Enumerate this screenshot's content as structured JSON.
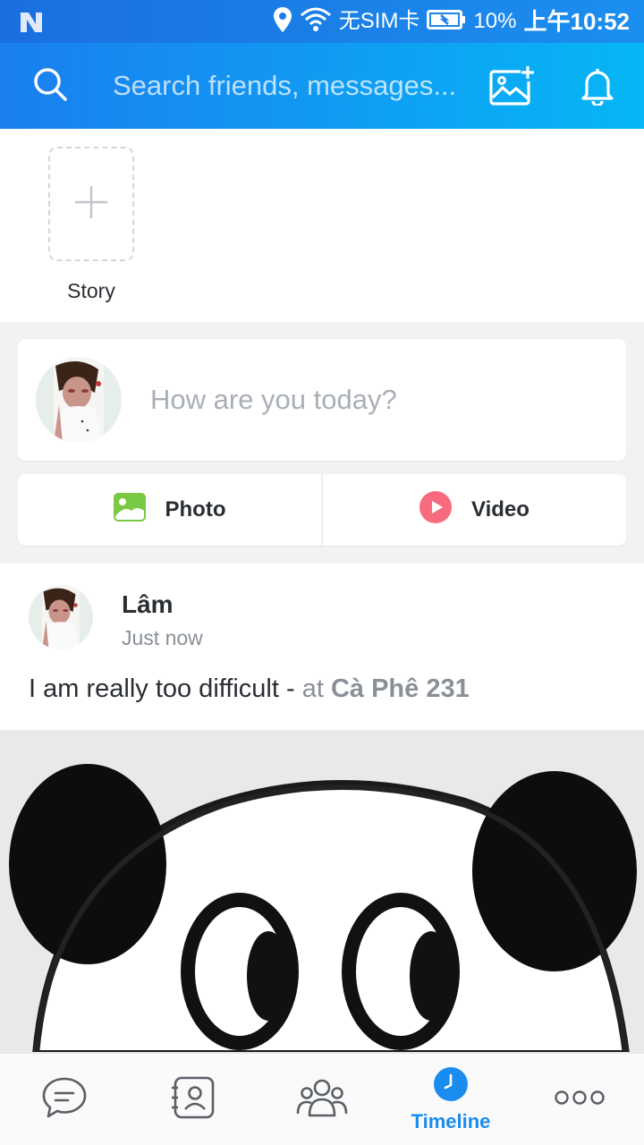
{
  "status_bar": {
    "carrier": "无SIM卡",
    "battery": "10%",
    "time": "上午10:52"
  },
  "search": {
    "placeholder": "Search friends, messages..."
  },
  "story": {
    "label": "Story"
  },
  "composer": {
    "placeholder": "How are you today?",
    "photo_label": "Photo",
    "video_label": "Video"
  },
  "post": {
    "author": "Lâm",
    "time": "Just now",
    "text": "I am really too difficult - ",
    "at_word": "at ",
    "place": "Cà Phê 231"
  },
  "bottom_nav": {
    "timeline_label": "Timeline"
  },
  "colors": {
    "accent": "#1a8cf0",
    "header_start": "#1b7ff0",
    "header_end": "#06b6f5",
    "photo_icon": "#7ac943",
    "video_icon": "#f86b7e"
  },
  "icons": [
    "search-icon",
    "add-photo-icon",
    "bell-icon",
    "plus-icon",
    "photo-icon",
    "video-icon",
    "chat-icon",
    "contacts-icon",
    "group-icon",
    "clock-icon",
    "more-icon"
  ]
}
